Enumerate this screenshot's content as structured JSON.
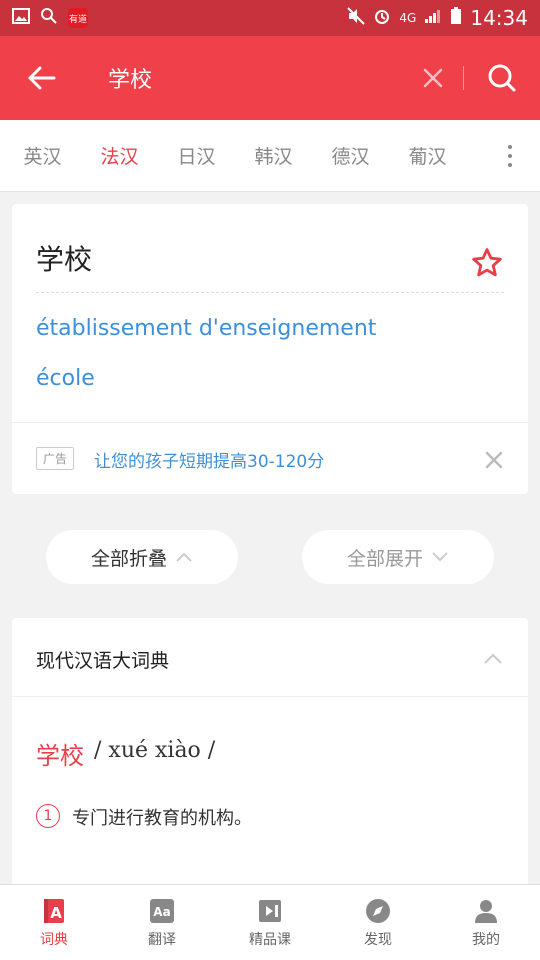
{
  "colors": {
    "status_bar": "#c8323c",
    "app_bar": "#f0404a",
    "accent": "#e8404a",
    "link": "#3d8fd9"
  },
  "status_bar": {
    "net_label": "4G",
    "app_badge": "有道",
    "time": "14:34"
  },
  "app_bar": {
    "query": "学校",
    "icons": {
      "back": "back-arrow-icon",
      "clear": "close-icon",
      "search": "search-icon"
    }
  },
  "lang_tabs": {
    "items": [
      {
        "label": "英汉",
        "active": false
      },
      {
        "label": "法汉",
        "active": true
      },
      {
        "label": "日汉",
        "active": false
      },
      {
        "label": "韩汉",
        "active": false
      },
      {
        "label": "德汉",
        "active": false
      },
      {
        "label": "葡汉",
        "active": false
      }
    ]
  },
  "result_card": {
    "word": "学校",
    "translations": [
      "établissement d'enseignement",
      "école"
    ],
    "ad_tag": "广告",
    "ad_text": "让您的孩子短期提高30-120分"
  },
  "controls": {
    "collapse_all": "全部折叠",
    "expand_all": "全部展开"
  },
  "dictionary": {
    "title": "现代汉语大词典",
    "headword": "学校",
    "pronunciation": "/ xué xiào /",
    "senses": [
      {
        "num": "1",
        "text": "专门进行教育的机构。"
      }
    ]
  },
  "bottom_nav": {
    "items": [
      {
        "label": "词典",
        "icon": "dictionary-icon",
        "active": true
      },
      {
        "label": "翻译",
        "icon": "translate-icon",
        "active": false
      },
      {
        "label": "精品课",
        "icon": "course-icon",
        "active": false
      },
      {
        "label": "发现",
        "icon": "compass-icon",
        "active": false
      },
      {
        "label": "我的",
        "icon": "profile-icon",
        "active": false
      }
    ]
  }
}
